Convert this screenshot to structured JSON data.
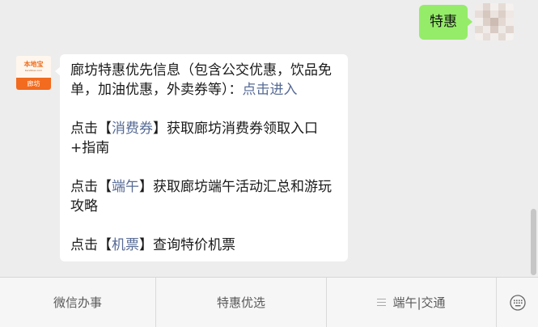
{
  "chat": {
    "sent_message": "特惠",
    "received": {
      "p1_text": "廊坊特惠优先信息（包含公交优惠，饮品免单，加油优惠，外卖券等）：",
      "p1_link": "点击进入",
      "p2_prefix": "点击【",
      "p2_link": "消费券",
      "p2_suffix": "】获取廊坊消费券领取入口+指南",
      "p3_prefix": "点击【",
      "p3_link": "端午",
      "p3_suffix": "】获取廊坊端午活动汇总和游玩攻略",
      "p4_prefix": "点击【",
      "p4_link": "机票",
      "p4_suffix": "】查询特价机票"
    },
    "bot_avatar": {
      "logo_name": "本地宝",
      "logo_url": "bendibao.com",
      "city": "廊坊"
    }
  },
  "menu": {
    "item1": "微信办事",
    "item2": "特惠优选",
    "item3": "端午|交通",
    "keyboard_icon": "keyboard-icon",
    "item3_icon": "hamburger-icon"
  },
  "colors": {
    "sent_bubble": "#95ec69",
    "link": "#576b95",
    "brand_orange": "#f26b1f",
    "background": "#ededed"
  }
}
